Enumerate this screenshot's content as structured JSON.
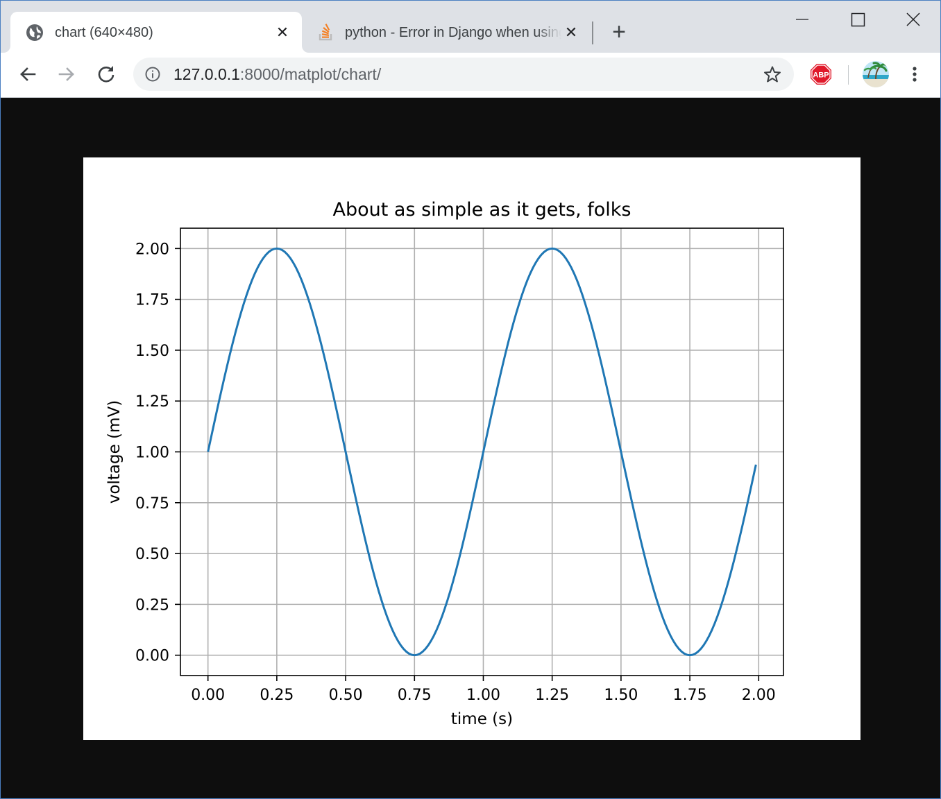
{
  "browser": {
    "tabs": [
      {
        "title": "chart (640×480)",
        "icon": "globe-icon",
        "active": true
      },
      {
        "title": "python - Error in Django when using matplotlib",
        "icon": "stackoverflow-icon",
        "active": false
      }
    ],
    "address": {
      "host": "127.0.0.1",
      "rest": ":8000/matplot/chart/"
    },
    "extensions": [
      {
        "name": "adblock-plus-icon",
        "label": "ABP",
        "color": "#e0192a"
      }
    ]
  },
  "chart_data": {
    "type": "line",
    "title": "About as simple as it gets, folks",
    "xlabel": "time (s)",
    "ylabel": "voltage (mV)",
    "xlim": [
      -0.1,
      2.09
    ],
    "ylim": [
      -0.1,
      2.1
    ],
    "x_ticks": [
      0.0,
      0.25,
      0.5,
      0.75,
      1.0,
      1.25,
      1.5,
      1.75,
      2.0
    ],
    "x_tick_labels": [
      "0.00",
      "0.25",
      "0.50",
      "0.75",
      "1.00",
      "1.25",
      "1.50",
      "1.75",
      "2.00"
    ],
    "y_ticks": [
      0.0,
      0.25,
      0.5,
      0.75,
      1.0,
      1.25,
      1.5,
      1.75,
      2.0
    ],
    "y_tick_labels": [
      "0.00",
      "0.25",
      "0.50",
      "0.75",
      "1.00",
      "1.25",
      "1.50",
      "1.75",
      "2.00"
    ],
    "grid": true,
    "series": [
      {
        "color": "#1f77b4",
        "function": "1 + sin(2*pi*t)",
        "x_start": 0.0,
        "x_end": 1.99,
        "x_step": 0.01
      }
    ]
  }
}
